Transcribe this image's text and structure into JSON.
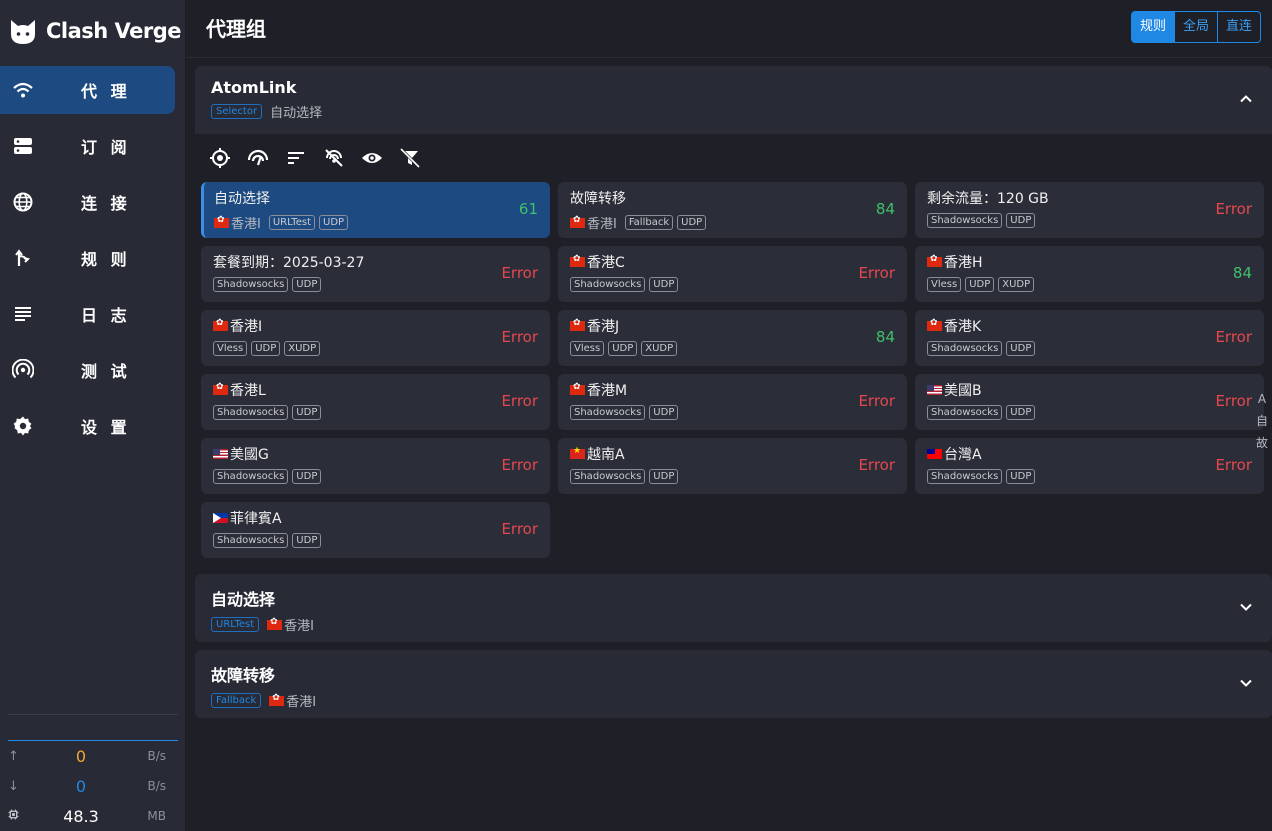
{
  "app": {
    "name": "Clash Verge"
  },
  "sidebar": {
    "items": [
      {
        "label": "代 理",
        "icon": "wifi-icon",
        "active": true
      },
      {
        "label": "订 阅",
        "icon": "server-icon",
        "active": false
      },
      {
        "label": "连 接",
        "icon": "globe-icon",
        "active": false
      },
      {
        "label": "规 则",
        "icon": "fork-icon",
        "active": false
      },
      {
        "label": "日 志",
        "icon": "list-icon",
        "active": false
      },
      {
        "label": "测 试",
        "icon": "signal-icon",
        "active": false
      },
      {
        "label": "设 置",
        "icon": "gear-icon",
        "active": false
      }
    ]
  },
  "traffic": {
    "upload": {
      "value": "0",
      "unit": "B/s",
      "color": "#f0a830"
    },
    "download": {
      "value": "0",
      "unit": "B/s",
      "color": "#1f88e5"
    },
    "memory": {
      "value": "48.3",
      "unit": "MB"
    }
  },
  "header": {
    "title": "代理组",
    "modes": [
      {
        "label": "规则",
        "active": true
      },
      {
        "label": "全局",
        "active": false
      },
      {
        "label": "直连",
        "active": false
      }
    ]
  },
  "groups": [
    {
      "name": "AtomLink",
      "type": "Selector",
      "current": "自动选择",
      "current_flag": ""
    },
    {
      "name": "自动选择",
      "type": "URLTest",
      "current": "香港I",
      "current_flag": "hk"
    },
    {
      "name": "故障转移",
      "type": "Fallback",
      "current": "香港I",
      "current_flag": "hk"
    }
  ],
  "toolbar_icons": [
    "locate-icon",
    "speed-test-icon",
    "sort-icon",
    "filter-off-icon",
    "eye-icon",
    "clear-filter-icon"
  ],
  "proxies": [
    {
      "name": "自动选择",
      "flag": "",
      "sub_flag": "hk",
      "sub": "香港I",
      "tags": [
        "URLTest",
        "UDP"
      ],
      "delay": "61",
      "status": "ok",
      "selected": true
    },
    {
      "name": "故障转移",
      "flag": "",
      "sub_flag": "hk",
      "sub": "香港I",
      "tags": [
        "Fallback",
        "UDP"
      ],
      "delay": "84",
      "status": "ok",
      "selected": false
    },
    {
      "name": "剩余流量：120 GB",
      "flag": "",
      "sub_flag": "",
      "sub": "",
      "tags": [
        "Shadowsocks",
        "UDP"
      ],
      "delay": "Error",
      "status": "err",
      "selected": false
    },
    {
      "name": "套餐到期：2025-03-27",
      "flag": "",
      "sub_flag": "",
      "sub": "",
      "tags": [
        "Shadowsocks",
        "UDP"
      ],
      "delay": "Error",
      "status": "err",
      "selected": false
    },
    {
      "name": "香港C",
      "flag": "hk",
      "sub_flag": "",
      "sub": "",
      "tags": [
        "Shadowsocks",
        "UDP"
      ],
      "delay": "Error",
      "status": "err",
      "selected": false
    },
    {
      "name": "香港H",
      "flag": "hk",
      "sub_flag": "",
      "sub": "",
      "tags": [
        "Vless",
        "UDP",
        "XUDP"
      ],
      "delay": "84",
      "status": "ok",
      "selected": false
    },
    {
      "name": "香港I",
      "flag": "hk",
      "sub_flag": "",
      "sub": "",
      "tags": [
        "Vless",
        "UDP",
        "XUDP"
      ],
      "delay": "Error",
      "status": "err",
      "selected": false
    },
    {
      "name": "香港J",
      "flag": "hk",
      "sub_flag": "",
      "sub": "",
      "tags": [
        "Vless",
        "UDP",
        "XUDP"
      ],
      "delay": "84",
      "status": "ok",
      "selected": false
    },
    {
      "name": "香港K",
      "flag": "hk",
      "sub_flag": "",
      "sub": "",
      "tags": [
        "Shadowsocks",
        "UDP"
      ],
      "delay": "Error",
      "status": "err",
      "selected": false
    },
    {
      "name": "香港L",
      "flag": "hk",
      "sub_flag": "",
      "sub": "",
      "tags": [
        "Shadowsocks",
        "UDP"
      ],
      "delay": "Error",
      "status": "err",
      "selected": false
    },
    {
      "name": "香港M",
      "flag": "hk",
      "sub_flag": "",
      "sub": "",
      "tags": [
        "Shadowsocks",
        "UDP"
      ],
      "delay": "Error",
      "status": "err",
      "selected": false
    },
    {
      "name": "美國B",
      "flag": "us",
      "sub_flag": "",
      "sub": "",
      "tags": [
        "Shadowsocks",
        "UDP"
      ],
      "delay": "Error",
      "status": "err",
      "selected": false
    },
    {
      "name": "美國G",
      "flag": "us",
      "sub_flag": "",
      "sub": "",
      "tags": [
        "Shadowsocks",
        "UDP"
      ],
      "delay": "Error",
      "status": "err",
      "selected": false
    },
    {
      "name": "越南A",
      "flag": "vn",
      "sub_flag": "",
      "sub": "",
      "tags": [
        "Shadowsocks",
        "UDP"
      ],
      "delay": "Error",
      "status": "err",
      "selected": false
    },
    {
      "name": "台灣A",
      "flag": "tw",
      "sub_flag": "",
      "sub": "",
      "tags": [
        "Shadowsocks",
        "UDP"
      ],
      "delay": "Error",
      "status": "err",
      "selected": false
    },
    {
      "name": "菲律賓A",
      "flag": "ph",
      "sub_flag": "",
      "sub": "",
      "tags": [
        "Shadowsocks",
        "UDP"
      ],
      "delay": "Error",
      "status": "err",
      "selected": false
    }
  ],
  "scroll_letters": [
    "A",
    "自",
    "故"
  ]
}
